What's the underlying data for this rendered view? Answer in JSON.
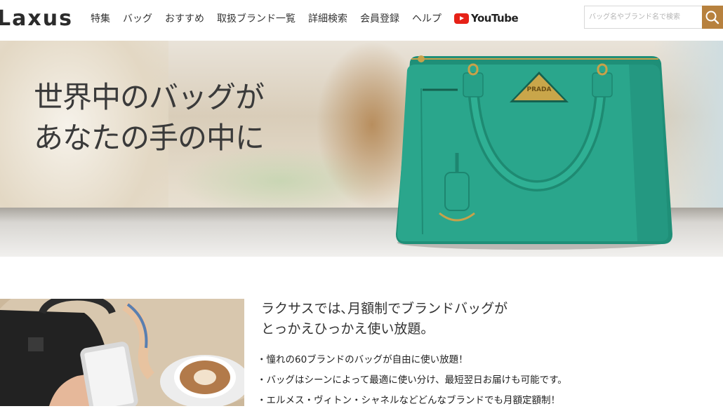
{
  "header": {
    "logo": "Laxus",
    "nav": [
      "特集",
      "バッグ",
      "おすすめ",
      "取扱ブランド一覧",
      "詳細検索",
      "会員登録",
      "ヘルプ"
    ],
    "youtube_label": "YouTube",
    "search": {
      "placeholder": "バッグ名やブランド名で検索"
    }
  },
  "hero": {
    "title_line1": "世界中のバッグが",
    "title_line2": "あなたの手の中に",
    "bag_logo": "PRADA"
  },
  "intro": {
    "heading_line1": "ラクサスでは､月額制でブランドバッグが",
    "heading_line2": "とっかえひっかえ使い放題。",
    "bullets": [
      "・憧れの60ブランドのバッグが自由に使い放題！",
      "・バッグはシーンによって最適に使い分け、最短翌日お届けも可能です。",
      "・エルメス・ヴィトン・シャネルなどどんなブランドでも月額定額制！"
    ]
  },
  "colors": {
    "accent": "#b7813e",
    "youtube": "#e62117",
    "bag": "#27a48a"
  },
  "icons": [
    "youtube-icon",
    "search-icon"
  ]
}
